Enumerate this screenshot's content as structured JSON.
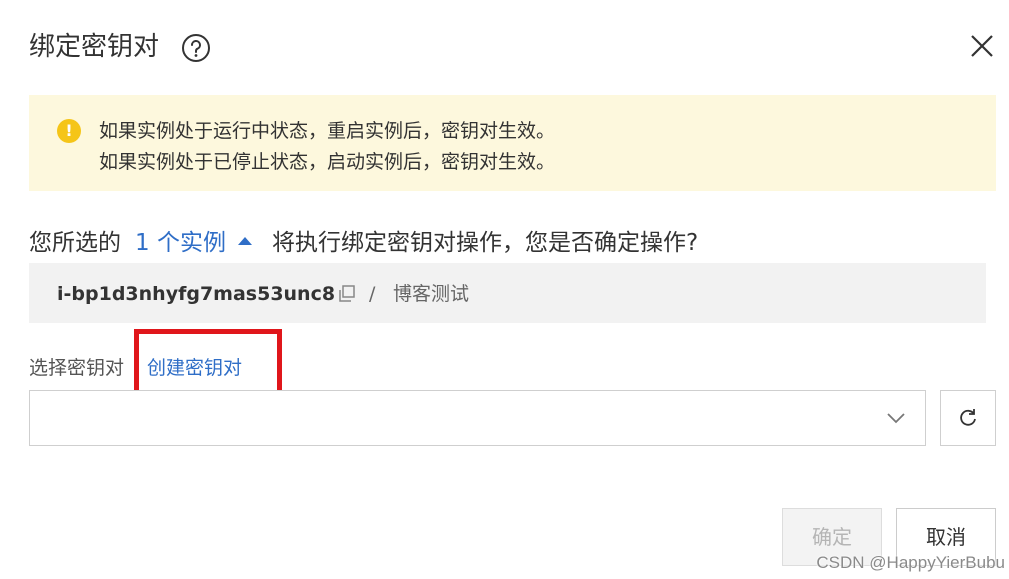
{
  "dialog": {
    "title": "绑定密钥对"
  },
  "notice": {
    "line1": "如果实例处于运行中状态，重启实例后，密钥对生效。",
    "line2": "如果实例处于已停止状态，启动实例后，密钥对生效。"
  },
  "confirm": {
    "prefix": "您所选的",
    "instances_link": "1 个实例",
    "suffix": "将执行绑定密钥对操作，您是否确定操作?"
  },
  "instance": {
    "id": "i-bp1d3nhyfg7mas53unc8",
    "separator": "/",
    "name": "博客测试"
  },
  "keypair": {
    "label": "选择密钥对",
    "create_link": "创建密钥对",
    "selected_value": ""
  },
  "footer": {
    "ok_label": "确定",
    "cancel_label": "取消"
  },
  "watermark": "CSDN @HappyYierBubu",
  "colors": {
    "link": "#2f6ec7",
    "notice_bg": "#fdf8dd",
    "warning": "#f5c518",
    "highlight": "#e0161b"
  },
  "icons": [
    "help-icon",
    "close-icon",
    "warning-icon",
    "caret-up-icon",
    "copy-icon",
    "chevron-down-icon",
    "refresh-icon"
  ]
}
